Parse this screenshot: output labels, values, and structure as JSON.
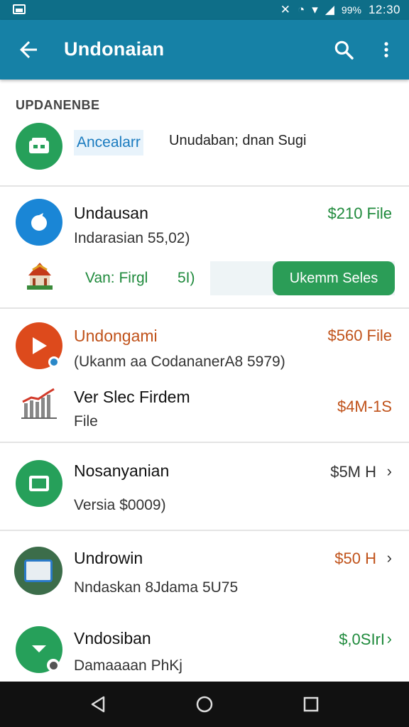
{
  "status_bar": {
    "battery_percent": "99%",
    "time": "12:30"
  },
  "app_bar": {
    "title": "Undonaian",
    "icons": [
      "back-arrow-icon",
      "search-icon",
      "more-vert-icon"
    ]
  },
  "section_header": "UPDANENBE",
  "featured": {
    "tag": "Ancealarr",
    "subtitle": "Unudaban; dnan Sugi",
    "icon": "store-icon"
  },
  "items": [
    {
      "title": "Undausan",
      "subtitle": "Indarasian 55,02)",
      "price": "$210 File",
      "icon": "app-blue-icon"
    },
    {
      "title": "Undongami",
      "subtitle": "(Ukanm aa CodananerA8 5979)",
      "price": "$560 File",
      "icon": "play-icon"
    },
    {
      "title": "Nosanyanian",
      "subtitle": "Versia $0009)",
      "price": "$5M H",
      "icon": "square-app-icon"
    },
    {
      "title": "Undrowin",
      "subtitle": "Nndaskan 8Jdama 5U75",
      "price": "$50 H",
      "icon": "photo-app-icon"
    },
    {
      "title": "Vndosiban",
      "subtitle": "Damaaaan PhKj",
      "price": "$,0SIrI",
      "icon": "download-icon"
    }
  ],
  "sub_row": {
    "label": "Van: Firgl",
    "count": "5I)",
    "button_label": "Ukemm Seles",
    "icon": "temple-icon"
  },
  "chart_row": {
    "title": "Ver Slec Firdem",
    "subtitle": "File",
    "price": "$4M-1S",
    "icon": "bar-chart-icon"
  },
  "colors": {
    "app_bar": "#1681a6",
    "status_bar": "#0e6e88",
    "accent_green": "#2b9d57",
    "price_green": "#1f8a3c",
    "price_orange": "#c0521a"
  }
}
